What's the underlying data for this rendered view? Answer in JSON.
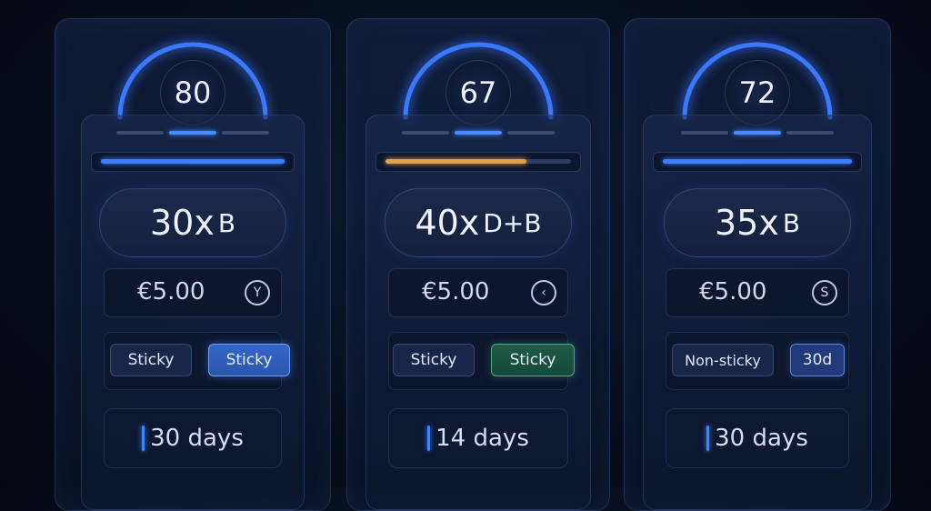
{
  "offers": [
    {
      "score": "80",
      "wager_multiplier": "30x",
      "wager_type": "B",
      "amount": "€5.00",
      "amount_icon": "y-icon",
      "amount_icon_glyph": "Y",
      "progress": 1.0,
      "progress_color": "#3d7dff",
      "toggle_left": "Sticky",
      "toggle_right": "Sticky",
      "toggle_right_style": "blue",
      "validity": "30 days"
    },
    {
      "score": "67",
      "wager_multiplier": "40x",
      "wager_type": "D+B",
      "amount": "€5.00",
      "amount_icon": "chevron-left-icon",
      "amount_icon_glyph": "‹",
      "progress": 0.76,
      "progress_color": "#e0a050",
      "toggle_left": "Sticky",
      "toggle_right": "Sticky",
      "toggle_right_style": "green",
      "validity": "14 days"
    },
    {
      "score": "72",
      "wager_multiplier": "35x",
      "wager_type": "B",
      "amount": "€5.00",
      "amount_icon": "s-icon",
      "amount_icon_glyph": "S",
      "progress": 1.0,
      "progress_color": "#3d7dff",
      "toggle_left": "Non-sticky",
      "toggle_right": "30d",
      "toggle_right_style": "navy",
      "validity": "30 days"
    }
  ],
  "colors": {
    "accent_blue": "#4a8cff",
    "accent_green": "#4ea987",
    "accent_orange": "#e0a050",
    "background": "#070d1c"
  }
}
